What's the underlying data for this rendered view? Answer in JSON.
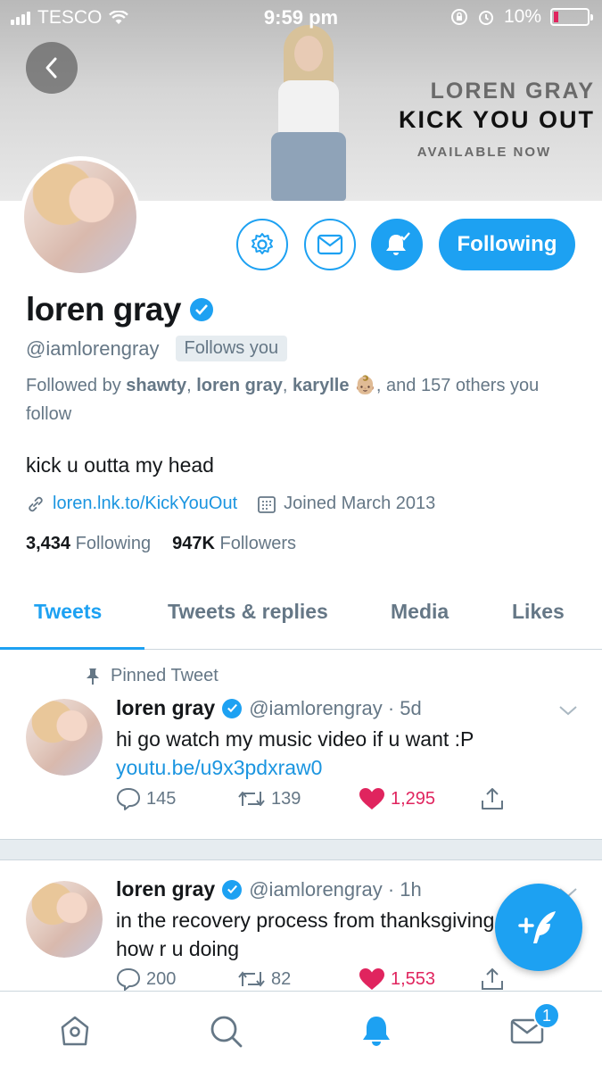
{
  "status_bar": {
    "carrier": "TESCO",
    "time": "9:59 pm",
    "battery": "10%"
  },
  "banner": {
    "line1": "LOREN GRAY",
    "line2": "KICK YOU OUT",
    "line3": "AVAILABLE NOW"
  },
  "profile": {
    "name": "loren gray",
    "handle": "@iamlorengray",
    "follows_you": "Follows you",
    "followed_by": {
      "prefix": "Followed by ",
      "names": [
        "shawty",
        "loren gray",
        "karylle 👶🏼"
      ],
      "suffix": ", and 157 others you follow"
    },
    "bio": "kick u outta my head",
    "link": "loren.lnk.to/KickYouOut",
    "joined": "Joined March 2013",
    "following_count": "3,434",
    "following_label": "Following",
    "followers_count": "947K",
    "followers_label": "Followers"
  },
  "actions": {
    "following_button": "Following"
  },
  "tabs": [
    "Tweets",
    "Tweets & replies",
    "Media",
    "Likes"
  ],
  "tweets": [
    {
      "pinned_label": "Pinned Tweet",
      "name": "loren gray",
      "handle_time": "@iamlorengray · 5d",
      "text": "hi go watch my music video if u want :P",
      "link": "youtu.be/u9x3pdxraw0",
      "replies": "145",
      "retweets": "139",
      "likes": "1,295"
    },
    {
      "name": "loren gray",
      "handle_time": "@iamlorengray · 1h",
      "text_line1": "in the recovery process from thanksgiving",
      "text_line2": "how r u doing",
      "replies": "200",
      "retweets": "82",
      "likes": "1,553"
    }
  ],
  "bottom_nav": {
    "items": [
      "home-icon",
      "search-icon",
      "notifications-icon",
      "messages-icon"
    ],
    "messages_badge": "1"
  },
  "colors": {
    "accent": "#1da1f2",
    "like": "#e0245e",
    "muted": "#657786"
  }
}
